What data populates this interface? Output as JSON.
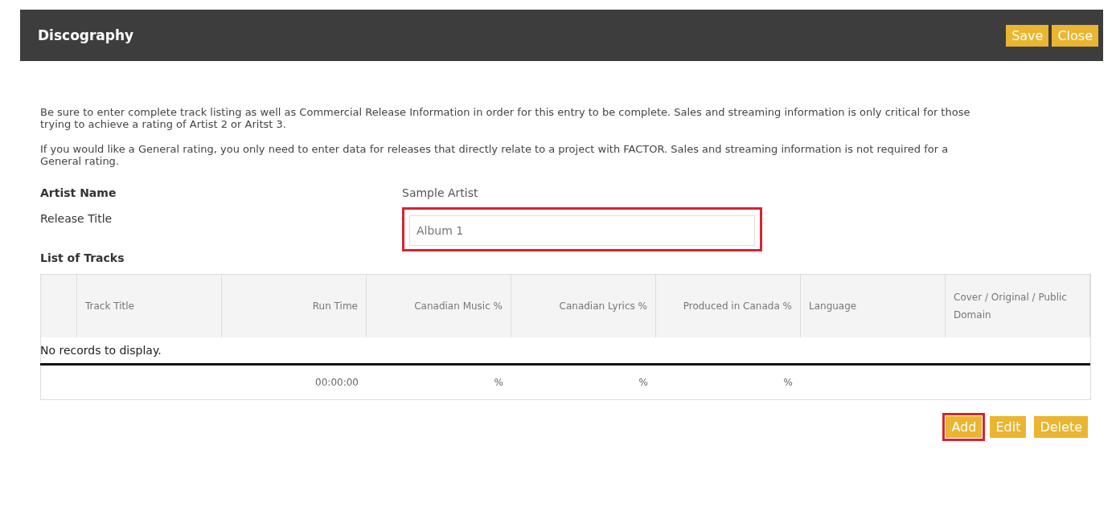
{
  "header": {
    "title": "Discography",
    "buttons": [
      {
        "label": "Save",
        "highlighted": false
      },
      {
        "label": "Close",
        "highlighted": false
      }
    ]
  },
  "intro": [
    "Be sure to enter complete track listing as well as Commercial Release Information in order for this entry to be complete. Sales and streaming information is only critical for those trying to achieve a rating of Artist 2 or Aritst 3.",
    "If you would like a General rating, you only need to enter data for releases that directly relate to a project with FACTOR. Sales and streaming information is not required for a General rating."
  ],
  "artist": {
    "label": "Artist Name",
    "value": "Sample Artist"
  },
  "release": {
    "label": "Release Title",
    "value": "Album 1",
    "highlighted": true
  },
  "tracks": {
    "title": "List of Tracks",
    "columns": [
      "Track Title",
      "Run Time",
      "Canadian Music %",
      "Canadian Lyrics %",
      "Produced in Canada %",
      "Language",
      "Cover / Original / Public Domain"
    ],
    "empty_message": "No records to display.",
    "footer": [
      "00:00:00",
      "%",
      "%",
      "%"
    ]
  },
  "buttons": [
    {
      "label": "Add",
      "highlighted": true
    },
    {
      "label": "Edit",
      "highlighted": false
    },
    {
      "label": "Delete",
      "highlighted": false
    }
  ]
}
